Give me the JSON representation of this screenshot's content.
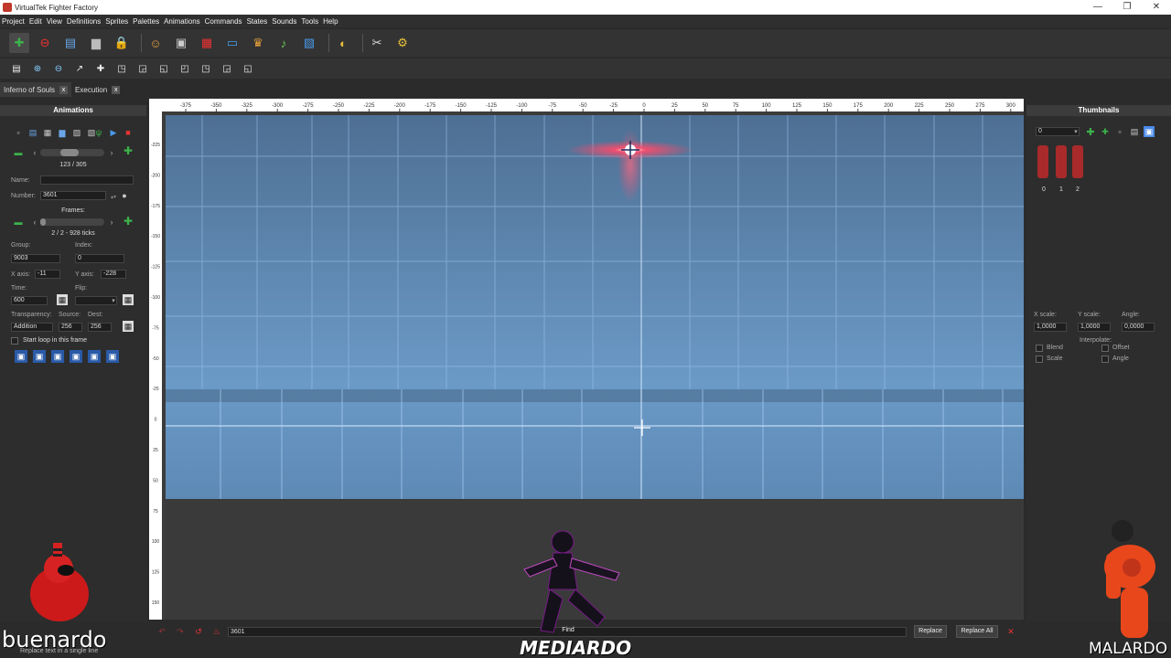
{
  "window": {
    "title": "VirtualTek Fighter Factory",
    "minimize": "—",
    "maximize": "❐",
    "close": "✕"
  },
  "menu": [
    "Project",
    "Edit",
    "View",
    "Definitions",
    "Sprites",
    "Palettes",
    "Animations",
    "Commands",
    "States",
    "Sounds",
    "Tools",
    "Help"
  ],
  "tabs": [
    {
      "label": "Inferno of Souls",
      "close": "x"
    },
    {
      "label": "Execution",
      "close": "x"
    }
  ],
  "rulers": {
    "top": [
      "-375",
      "-350",
      "-325",
      "-300",
      "-275",
      "-250",
      "-225",
      "-200",
      "-175",
      "-150",
      "-125",
      "-100",
      "-75",
      "-50",
      "-25",
      "0",
      "25",
      "50",
      "75",
      "100",
      "125",
      "150",
      "175",
      "200",
      "225",
      "250",
      "275",
      "300"
    ],
    "left": [
      "-225",
      "-200",
      "-175",
      "-150",
      "-125",
      "-100",
      "-75",
      "-50",
      "-25",
      "0",
      "25",
      "50",
      "75",
      "100",
      "125",
      "150"
    ]
  },
  "animations": {
    "header": "Animations",
    "counter": "123 / 305",
    "name_label": "Name:",
    "name_value": "",
    "number_label": "Number:",
    "number_value": "3601",
    "frames_label": "Frames:",
    "frames_counter": "2 / 2 - 928 ticks",
    "group_label": "Group:",
    "group_value": "9003",
    "index_label": "Index:",
    "index_value": "0",
    "xaxis_label": "X axis:",
    "xaxis_value": "-11",
    "yaxis_label": "Y axis:",
    "yaxis_value": "-228",
    "time_label": "Time:",
    "time_value": "600",
    "flip_label": "Flip:",
    "flip_value": "",
    "transparency_label": "Transparency:",
    "transparency_value": "Addition",
    "source_label": "Source:",
    "source_value": "256",
    "dest_label": "Dest:",
    "dest_value": "256",
    "loop_label": "Start loop in this frame"
  },
  "thumbnails": {
    "header": "Thumbnails",
    "select_value": "0",
    "items": [
      "0",
      "1",
      "2"
    ],
    "xscale_label": "X scale:",
    "xscale_value": "1,0000",
    "yscale_label": "Y scale:",
    "yscale_value": "1,0000",
    "angle_label": "Angle:",
    "angle_value": "0,0000",
    "interpolate_label": "Interpolate:",
    "blend_label": "Blend",
    "offset_label": "Offset",
    "scale_label": "Scale",
    "angle_check_label": "Angle"
  },
  "bottom": {
    "search_value": "3601",
    "find_label": "Find",
    "replace_label": "Replace",
    "replace_all_label": "Replace All"
  },
  "status": {
    "text": "Replace text in a single line"
  },
  "overlay": {
    "left_name": "buenardo",
    "center_name": "MEDIARDO",
    "right_name": "MALARDO"
  },
  "colors": {
    "panel": "#2d2d2d",
    "stage_top": "#4e6f93",
    "stage_bottom": "#6b9ac7",
    "accent": "#e8454a"
  }
}
